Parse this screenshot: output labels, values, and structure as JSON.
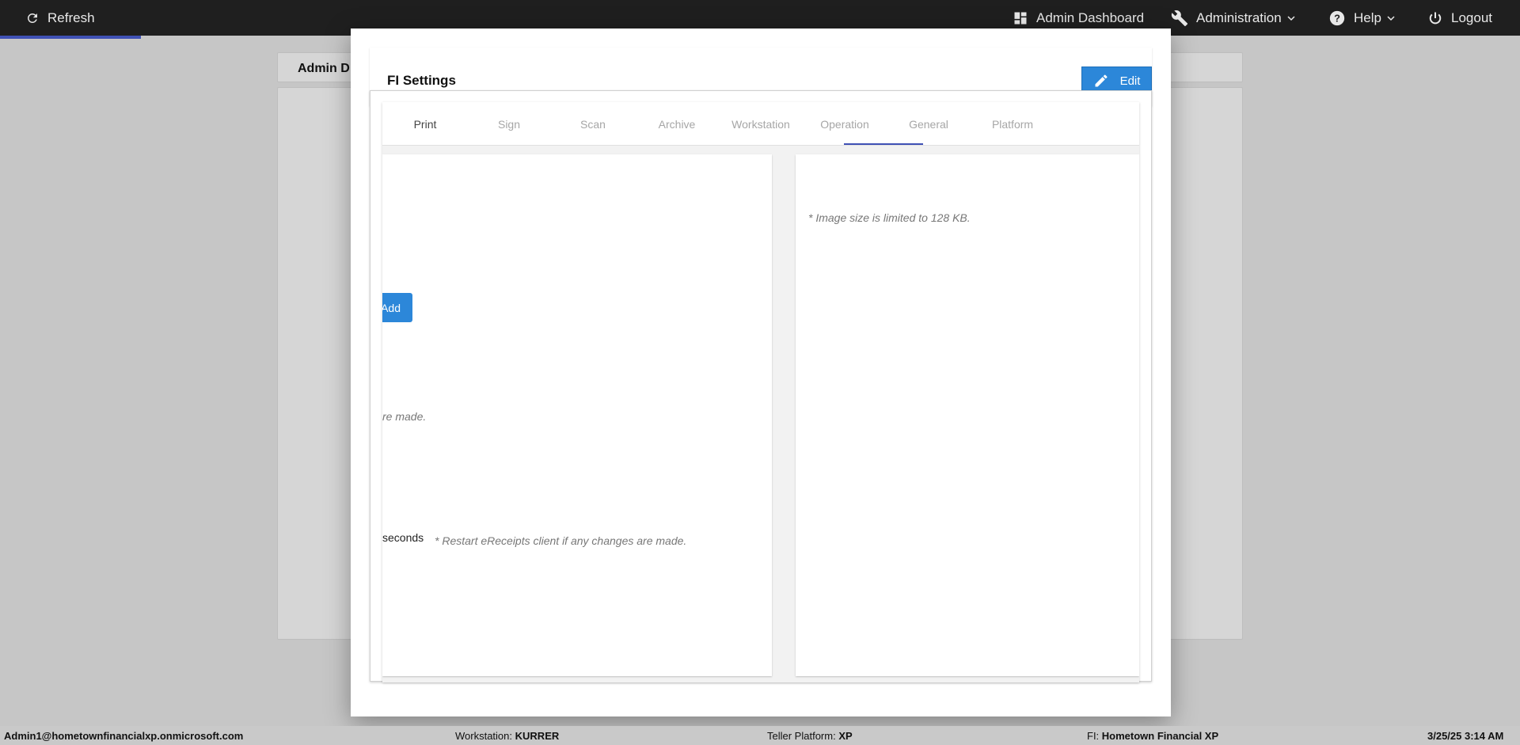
{
  "topbar": {
    "refresh": "Refresh",
    "admin_dashboard": "Admin Dashboard",
    "administration": "Administration",
    "help": "Help",
    "logout": "Logout",
    "progress_percent": 9.3
  },
  "background": {
    "header_title": "Admin D"
  },
  "modal": {
    "title": "FI Settings",
    "edit_label": "Edit",
    "tabs": [
      {
        "label": "Print"
      },
      {
        "label": "Sign"
      },
      {
        "label": "Scan"
      },
      {
        "label": "Archive"
      },
      {
        "label": "Workstation"
      },
      {
        "label": "Operation"
      },
      {
        "label": "General"
      },
      {
        "label": "Platform"
      }
    ],
    "active_tab": "General",
    "left": {
      "add_label": "Add",
      "note_truncated": "re made.",
      "seconds_label": "seconds",
      "restart_note": "* Restart eReceipts client if any changes are made."
    },
    "right": {
      "image_note": "* Image size is limited to 128 KB."
    }
  },
  "footer": {
    "user": "Admin1@hometownfinancialxp.onmicrosoft.com",
    "workstation_label": "Workstation:",
    "workstation_value": "KURRER",
    "platform_label": "Teller Platform:",
    "platform_value": "XP",
    "fi_label": "FI:",
    "fi_value": "Hometown Financial XP",
    "datetime": "3/25/25 3:14 AM"
  },
  "colors": {
    "accent": "#2c87d9",
    "tab_indicator": "#3f51b5",
    "topbar": "#1f1f1f"
  }
}
